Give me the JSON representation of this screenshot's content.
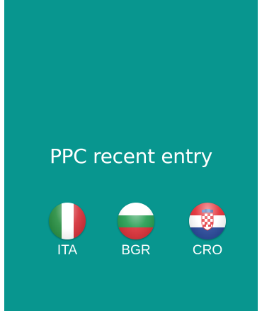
{
  "title": "PPC recent entry",
  "colors": {
    "background": "#08968f",
    "text": "#ffffff"
  },
  "countries": [
    {
      "code": "ITA",
      "flag_icon": "italy-flag-icon"
    },
    {
      "code": "BGR",
      "flag_icon": "bulgaria-flag-icon"
    },
    {
      "code": "CRO",
      "flag_icon": "croatia-flag-icon"
    }
  ]
}
